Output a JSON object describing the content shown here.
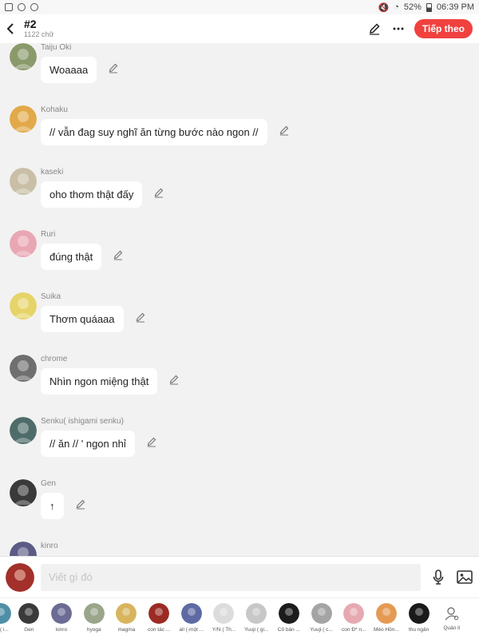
{
  "status_bar": {
    "battery": "52%",
    "time": "06:39 PM"
  },
  "header": {
    "title": "#2",
    "subtitle": "1122 chữ",
    "next_label": "Tiếp theo"
  },
  "messages": [
    {
      "sender": "Taiju Oki",
      "text": "Woaaaa",
      "avatar_color": "#8a9a6a"
    },
    {
      "sender": "Kohaku",
      "text": "// vẫn đag suy nghĩ ăn từng bước nào ngon //",
      "avatar_color": "#e2a94a"
    },
    {
      "sender": "kaseki",
      "text": "oho thơm thật đấy",
      "avatar_color": "#c9bfa6"
    },
    {
      "sender": "Ruri",
      "text": "đúng thật",
      "avatar_color": "#e9a7b4"
    },
    {
      "sender": "Suika",
      "text": "Thơm quáaaa",
      "avatar_color": "#e6d46a"
    },
    {
      "sender": "chrome",
      "text": "Nhìn ngon miệng thật",
      "avatar_color": "#6f6f6f"
    },
    {
      "sender": "Senku( ishigami senku)",
      "text": "// ăn // ' ngon nhỉ",
      "avatar_color": "#4e6c6a"
    },
    {
      "sender": "Gen",
      "text": "↑",
      "avatar_color": "#3a3a3a"
    },
    {
      "sender": "kinro",
      "text": "",
      "avatar_color": "#5b5b86"
    }
  ],
  "composer": {
    "placeholder": "Viết gì đó",
    "avatar_color": "#a3302a"
  },
  "characters": [
    {
      "name": "( i...",
      "color": "#4f8fa6"
    },
    {
      "name": "Gen",
      "color": "#3a3a3a"
    },
    {
      "name": "kinro",
      "color": "#6b6b94"
    },
    {
      "name": "hyoga",
      "color": "#9aa58a"
    },
    {
      "name": "magma",
      "color": "#d8b45c"
    },
    {
      "name": "con tác ...",
      "color": "#9b2b24"
    },
    {
      "name": "all (-một ...",
      "color": "#5d6aa3"
    },
    {
      "name": "Y/N ( Th...",
      "color": "#dcdcdc"
    },
    {
      "name": "Yuuji ( gi...",
      "color": "#c7c7c7"
    },
    {
      "name": "Cô bán ...",
      "color": "#1c1c1c"
    },
    {
      "name": "Yuuji ( c...",
      "color": "#a4a4a4"
    },
    {
      "name": "con Đ* n...",
      "color": "#e6a9b1"
    },
    {
      "name": "Mèo Hồn...",
      "color": "#e59a53"
    },
    {
      "name": "thu ngân",
      "color": "#1a1a1a"
    }
  ],
  "manage_label": "Quản lí",
  "colors": {
    "accent": "#f0413f",
    "bubble": "#ffffff",
    "background": "#f2f2f2"
  }
}
